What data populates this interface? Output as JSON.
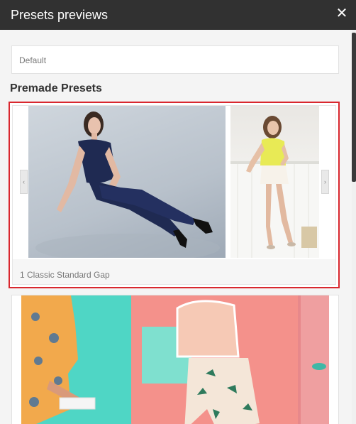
{
  "dialog": {
    "title": "Presets previews",
    "close_icon": "close-icon"
  },
  "select": {
    "value": "Default"
  },
  "section": {
    "title": "Premade Presets"
  },
  "presets": [
    {
      "label": "1 Classic Standard Gap",
      "selected": true
    },
    {
      "label": "",
      "selected": false
    }
  ],
  "colors": {
    "header_bg": "#313131",
    "selected_border": "#d9272e",
    "panel_bg": "#f4f4f4"
  }
}
